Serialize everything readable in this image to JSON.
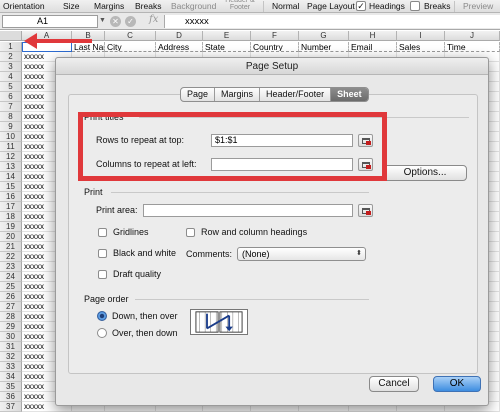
{
  "ribbon": {
    "items": [
      "Orientation",
      "Size",
      "Margins",
      "Breaks",
      "Background",
      "Header & Footer",
      "Normal",
      "Page Layout",
      "Headings",
      "Breaks",
      "Preview"
    ],
    "headings_checked": true
  },
  "formula_bar": {
    "cell_ref": "A1",
    "fx_label": "fx",
    "value": "xxxxx"
  },
  "sheet": {
    "columns": [
      "A",
      "B",
      "C",
      "D",
      "E",
      "F",
      "G",
      "H",
      "I",
      "J"
    ],
    "header_row": [
      "",
      "Last Name",
      "City",
      "Address",
      "State",
      "Country",
      "Number",
      "Email",
      "Sales",
      "Time"
    ],
    "row_numbers": [
      "1",
      "2",
      "3",
      "4",
      "5",
      "6",
      "7",
      "8",
      "9",
      "10",
      "11",
      "12",
      "13",
      "14",
      "15",
      "16",
      "17",
      "18",
      "19",
      "20",
      "21",
      "22",
      "23",
      "24",
      "25",
      "26",
      "27",
      "28",
      "29",
      "30",
      "31",
      "32",
      "33",
      "34",
      "35",
      "36",
      "37"
    ],
    "cell_value": "xxxxx"
  },
  "dialog": {
    "title": "Page Setup",
    "tabs": [
      "Page",
      "Margins",
      "Header/Footer",
      "Sheet"
    ],
    "active_tab": "Sheet",
    "print_titles": {
      "section_label": "Print titles",
      "rows_label": "Rows to repeat at top:",
      "rows_value": "$1:$1",
      "cols_label": "Columns to repeat at left:",
      "cols_value": ""
    },
    "options_button": "Options...",
    "print": {
      "section_label": "Print",
      "print_area_label": "Print area:",
      "print_area_value": "",
      "gridlines": "Gridlines",
      "black_and_white": "Black and white",
      "draft_quality": "Draft quality",
      "row_col_headings": "Row and column headings",
      "comments_label": "Comments:",
      "comments_value": "(None)"
    },
    "page_order": {
      "section_label": "Page order",
      "down_then_over": "Down, then over",
      "over_then_down": "Over, then down",
      "selected": "down_then_over"
    },
    "cancel_button": "Cancel",
    "ok_button": "OK"
  },
  "colors": {
    "highlight": "#e0383b",
    "arrow": "#e0383b",
    "ok_button": "#3d8de0"
  }
}
